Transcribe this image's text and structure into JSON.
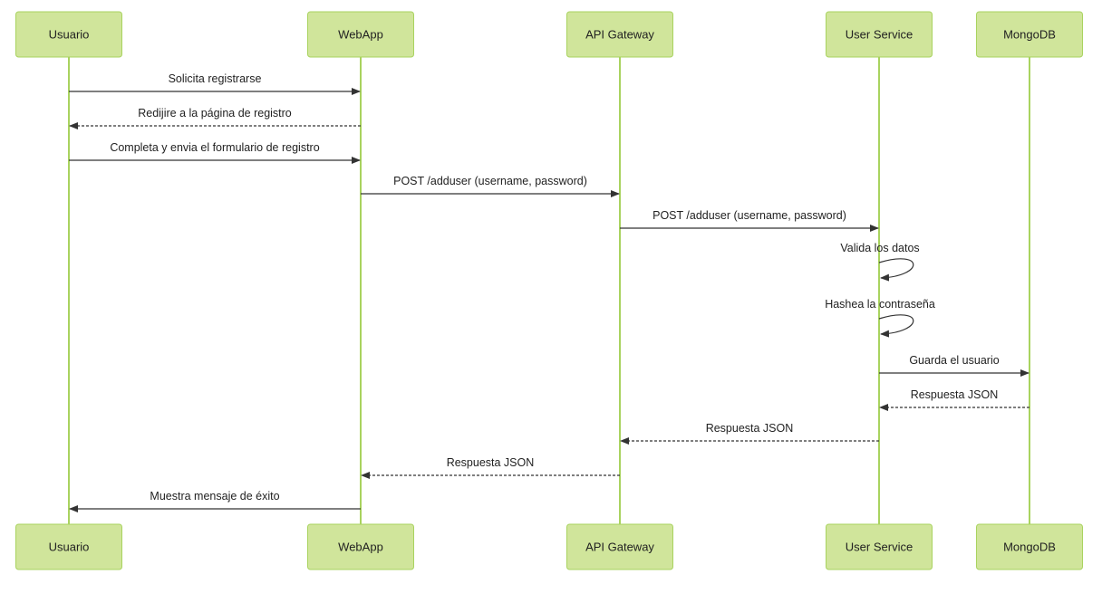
{
  "diagram": {
    "type": "sequence",
    "participants": [
      {
        "id": "usuario",
        "label": "Usuario"
      },
      {
        "id": "webapp",
        "label": "WebApp"
      },
      {
        "id": "gateway",
        "label": "API Gateway"
      },
      {
        "id": "userservice",
        "label": "User Service"
      },
      {
        "id": "mongodb",
        "label": "MongoDB"
      }
    ],
    "messages": [
      {
        "from": "usuario",
        "to": "webapp",
        "label": "Solicita registrarse",
        "style": "solid"
      },
      {
        "from": "webapp",
        "to": "usuario",
        "label": "Redijire a la página de registro",
        "style": "dashed"
      },
      {
        "from": "usuario",
        "to": "webapp",
        "label": "Completa y envia el formulario de registro",
        "style": "solid"
      },
      {
        "from": "webapp",
        "to": "gateway",
        "label": "POST /adduser (username, password)",
        "style": "solid"
      },
      {
        "from": "gateway",
        "to": "userservice",
        "label": "POST /adduser (username, password)",
        "style": "solid"
      },
      {
        "from": "userservice",
        "to": "userservice",
        "label": "Valida los datos",
        "style": "solid"
      },
      {
        "from": "userservice",
        "to": "userservice",
        "label": "Hashea la contraseña",
        "style": "solid"
      },
      {
        "from": "userservice",
        "to": "mongodb",
        "label": "Guarda el usuario",
        "style": "solid"
      },
      {
        "from": "mongodb",
        "to": "userservice",
        "label": "Respuesta JSON",
        "style": "dashed"
      },
      {
        "from": "userservice",
        "to": "gateway",
        "label": "Respuesta JSON",
        "style": "dashed"
      },
      {
        "from": "gateway",
        "to": "webapp",
        "label": "Respuesta JSON",
        "style": "dashed"
      },
      {
        "from": "webapp",
        "to": "usuario",
        "label": "Muestra mensaje de éxito",
        "style": "solid"
      }
    ]
  },
  "colors": {
    "actor_fill": "#d0e59b",
    "actor_stroke": "#a9d35f",
    "lifeline": "#a9d35f",
    "arrow": "#333333"
  }
}
